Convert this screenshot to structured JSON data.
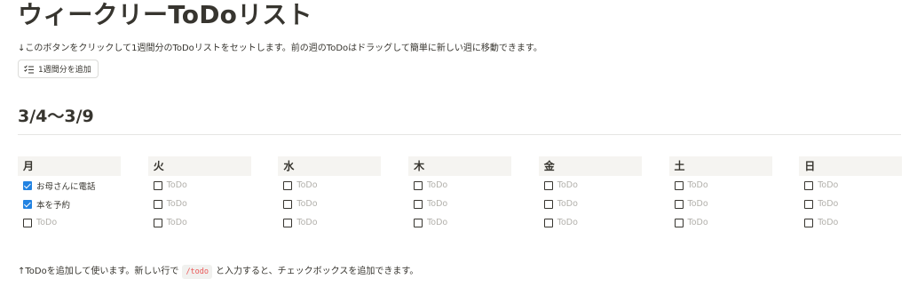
{
  "page": {
    "title": "ウィークリーToDoリスト",
    "description": "↓このボタンをクリックして1週間分のToDoリストをセットします。前の週のToDoはドラッグして簡単に新しい週に移動できます。",
    "add_button_label": "1週間分を追加",
    "add_button_icon": "checklist-icon"
  },
  "week": {
    "heading": "3/4〜3/9",
    "days": [
      {
        "label": "月",
        "todos": [
          {
            "text": "お母さんに電話",
            "checked": true
          },
          {
            "text": "本を予約",
            "checked": true
          },
          {
            "text": "ToDo",
            "checked": false,
            "placeholder": true
          }
        ]
      },
      {
        "label": "火",
        "todos": [
          {
            "text": "ToDo",
            "checked": false,
            "placeholder": true
          },
          {
            "text": "ToDo",
            "checked": false,
            "placeholder": true
          },
          {
            "text": "ToDo",
            "checked": false,
            "placeholder": true
          }
        ]
      },
      {
        "label": "水",
        "todos": [
          {
            "text": "ToDo",
            "checked": false,
            "placeholder": true
          },
          {
            "text": "ToDo",
            "checked": false,
            "placeholder": true
          },
          {
            "text": "ToDo",
            "checked": false,
            "placeholder": true
          }
        ]
      },
      {
        "label": "木",
        "todos": [
          {
            "text": "ToDo",
            "checked": false,
            "placeholder": true
          },
          {
            "text": "ToDo",
            "checked": false,
            "placeholder": true
          },
          {
            "text": "ToDo",
            "checked": false,
            "placeholder": true
          }
        ]
      },
      {
        "label": "金",
        "todos": [
          {
            "text": "ToDo",
            "checked": false,
            "placeholder": true
          },
          {
            "text": "ToDo",
            "checked": false,
            "placeholder": true
          },
          {
            "text": "ToDo",
            "checked": false,
            "placeholder": true
          }
        ]
      },
      {
        "label": "土",
        "todos": [
          {
            "text": "ToDo",
            "checked": false,
            "placeholder": true
          },
          {
            "text": "ToDo",
            "checked": false,
            "placeholder": true
          },
          {
            "text": "ToDo",
            "checked": false,
            "placeholder": true
          }
        ]
      },
      {
        "label": "日",
        "todos": [
          {
            "text": "ToDo",
            "checked": false,
            "placeholder": true
          },
          {
            "text": "ToDo",
            "checked": false,
            "placeholder": true
          },
          {
            "text": "ToDo",
            "checked": false,
            "placeholder": true
          }
        ]
      }
    ]
  },
  "footer": {
    "text_before": "↑ToDoを追加して使います。新しい行で",
    "code": "/todo",
    "text_after": "と入力すると、チェックボックスを追加できます。"
  },
  "colors": {
    "checkbox_checked": "#2383e2",
    "placeholder_text": "#b2b0ab",
    "header_bg": "#f5f4f1",
    "code_text": "#eb5757"
  }
}
